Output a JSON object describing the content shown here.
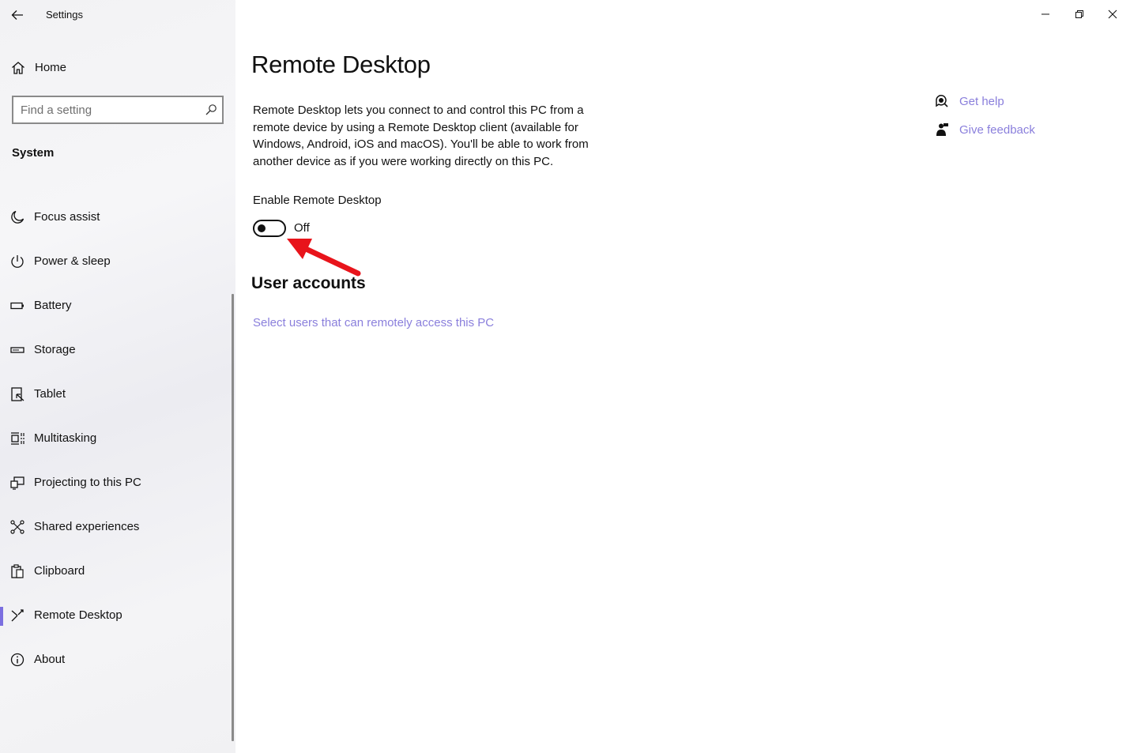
{
  "window": {
    "title": "Settings",
    "controls": {
      "minimize": "minimize",
      "restore": "restore",
      "close": "close"
    }
  },
  "sidebar": {
    "home_label": "Home",
    "search": {
      "placeholder": "Find a setting",
      "value": ""
    },
    "section_title": "System",
    "items": [
      {
        "label": "Focus assist",
        "icon": "moon-icon"
      },
      {
        "label": "Power & sleep",
        "icon": "power-icon"
      },
      {
        "label": "Battery",
        "icon": "battery-icon"
      },
      {
        "label": "Storage",
        "icon": "storage-icon"
      },
      {
        "label": "Tablet",
        "icon": "tablet-icon"
      },
      {
        "label": "Multitasking",
        "icon": "multitasking-icon"
      },
      {
        "label": "Projecting to this PC",
        "icon": "projecting-icon"
      },
      {
        "label": "Shared experiences",
        "icon": "shared-icon"
      },
      {
        "label": "Clipboard",
        "icon": "clipboard-icon"
      },
      {
        "label": "Remote Desktop",
        "icon": "remote-desktop-icon",
        "selected": true
      },
      {
        "label": "About",
        "icon": "info-icon"
      }
    ]
  },
  "main": {
    "title": "Remote Desktop",
    "description": "Remote Desktop lets you connect to and control this PC from a remote device by using a Remote Desktop client (available for Windows, Android, iOS and macOS). You'll be able to work from another device as if you were working directly on this PC.",
    "toggle": {
      "label": "Enable Remote Desktop",
      "state": "Off",
      "on": false
    },
    "user_accounts": {
      "heading": "User accounts",
      "link": "Select users that can remotely access this PC"
    }
  },
  "help": {
    "get_help": "Get help",
    "give_feedback": "Give feedback"
  },
  "colors": {
    "accent": "#7b6fe0",
    "link": "#8a7fdc",
    "annotation_arrow": "#e8141b"
  }
}
